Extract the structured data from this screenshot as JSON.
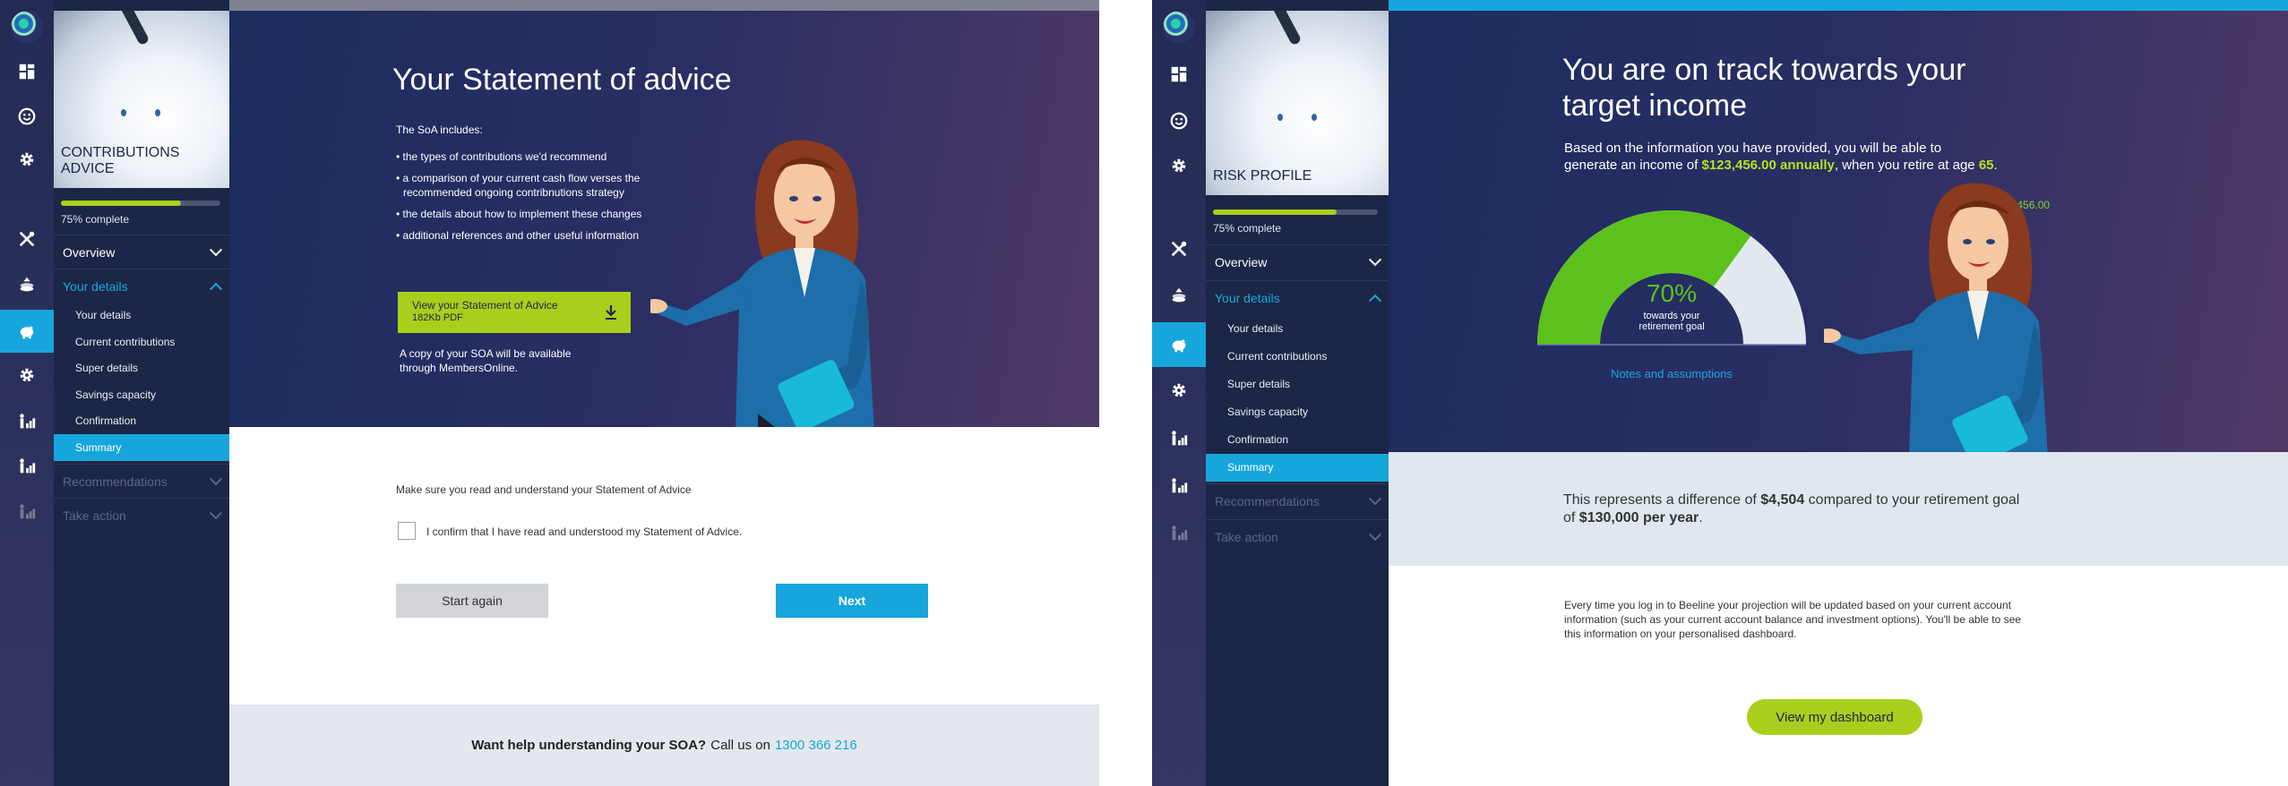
{
  "colors": {
    "accent_blue": "#17a6dc",
    "lime": "#a9cf1c",
    "navy": "#1c2646"
  },
  "left": {
    "side": {
      "hero_label": "CONTRIBUTIONS ADVICE",
      "progress_text": "75% complete",
      "progress_value": 0.75,
      "overview": "Overview",
      "your_details": "Your details",
      "items": [
        "Your details",
        "Current contributions",
        "Super details",
        "Savings capacity",
        "Confirmation",
        "Summary"
      ],
      "recommendations": "Recommendations",
      "take_action": "Take action"
    },
    "hero": {
      "title": "Your Statement of advice",
      "intro": "The SoA includes:",
      "bullets": [
        "• the types of contributions we'd recommend",
        "• a comparison of your current cash flow verses the",
        "recommended ongoing contribnutions strategy",
        "• the details about how to implement these changes",
        "• additional references and other useful information"
      ],
      "cta_title": "View your Statement of Advice",
      "cta_sub": "182Kb PDF",
      "copy_note_1": "A copy of your SOA will be available",
      "copy_note_2": "through MembersOnline."
    },
    "body": {
      "read_note": "Make sure you read and understand your Statement of Advice",
      "confirm_label": "I confirm that I have read and understood my Statement of Advice.",
      "start_again": "Start again",
      "next": "Next"
    },
    "footer": {
      "question": "Want help understanding your SOA?",
      "call": "Call us on",
      "phone": "1300 366 216"
    }
  },
  "right": {
    "side": {
      "hero_label": "RISK PROFILE",
      "progress_text": "75% complete",
      "progress_value": 0.75,
      "overview": "Overview",
      "your_details": "Your details",
      "items": [
        "Your details",
        "Current contributions",
        "Super details",
        "Savings capacity",
        "Confirmation",
        "Summary"
      ],
      "recommendations": "Recommendations",
      "take_action": "Take action"
    },
    "hero": {
      "title_1": "You are on track towards your",
      "title_2": "target income",
      "desc_1": "Based on the information you have provided, you will be able to",
      "desc_2a": "generate an income of",
      "income": "$123,456.00 annually",
      "desc_2b": ", when you retire at age",
      "age": "65",
      "desc_2c": ".",
      "gauge_value_label": "123,456.00",
      "gauge_percent": "70%",
      "gauge_percent_value": 70,
      "gauge_sub_1": "towards your",
      "gauge_sub_2": "retirement goal",
      "notes_link": "Notes and assumptions"
    },
    "band": {
      "text_a": "This represents a difference of",
      "diff": "$4,504",
      "text_b": "compared to your retirement goal",
      "text_c": "of",
      "goal": "$130,000 per year",
      "text_d": "."
    },
    "body": {
      "info_1": "Every time you log in to Beeline your projection will be updated based on your current account",
      "info_2": "information (such as your current account balance and investment options). You'll be able to see",
      "info_3": "this information on your personalised dashboard.",
      "dashboard_button": "View my dashboard"
    }
  },
  "icons": [
    "logo-icon",
    "dashboard-icon",
    "smiley-icon",
    "gear-icon",
    "tools-icon",
    "coins-icon",
    "piggy-bank-icon",
    "settings-icon",
    "person-chart-icon",
    "person-chart-2-icon",
    "person-chart-3-icon",
    "download-icon",
    "checkbox-icon"
  ]
}
